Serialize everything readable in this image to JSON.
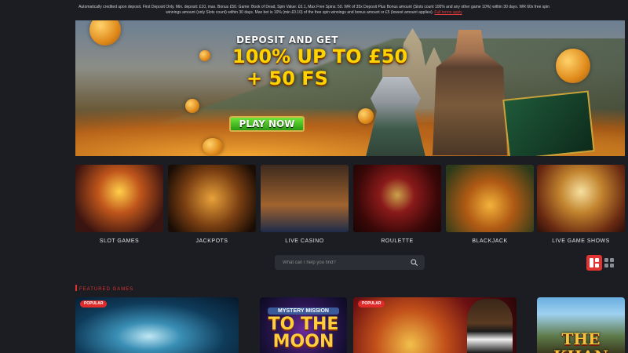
{
  "terms": {
    "text": "Automatically credited upon deposit. First Deposit Only. Min. deposit: £10, max. Bonus £50. Game: Book of Dead, Spin Value: £0.1, Max Free Spins: 50. WR of 35x Deposit Plus Bonus amount (Slots count 100% and any other game 10%) within 30 days. WR 60x free spin winnings amount (only Slots count) within 30 days. Max bet is 10% (min £0.10) of the free spin winnings and bonus amount or £5 (lowest amount applies).",
    "link": "Full terms apply"
  },
  "banner": {
    "line1": "DEPOSIT AND GET",
    "line2": "100% UP TO £50",
    "line3": "+ 50 FS",
    "cta": "PLAY NOW"
  },
  "categories": [
    {
      "label": "SLOT GAMES",
      "art": "t-slot"
    },
    {
      "label": "JACKPOTS",
      "art": "t-jack"
    },
    {
      "label": "LIVE CASINO",
      "art": "t-live"
    },
    {
      "label": "ROULETTE",
      "art": "t-roul"
    },
    {
      "label": "BLACKJACK",
      "art": "t-black"
    },
    {
      "label": "LIVE GAME SHOWS",
      "art": "t-show"
    }
  ],
  "search": {
    "placeholder": "What can I help you find?",
    "icon": "search-icon"
  },
  "view_toggle": {
    "grid_view": "grid-large-icon",
    "list_view": "grid-small-icon",
    "accent": "#e23333"
  },
  "featured": {
    "title": "FEATURED GAMES",
    "games": [
      {
        "badge": "POPULAR"
      },
      {
        "title_small": "MYSTERY MISSION",
        "title_big": "TO THE MOON"
      },
      {
        "badge": "POPULAR"
      },
      {
        "title": "THE KHAN"
      }
    ]
  }
}
